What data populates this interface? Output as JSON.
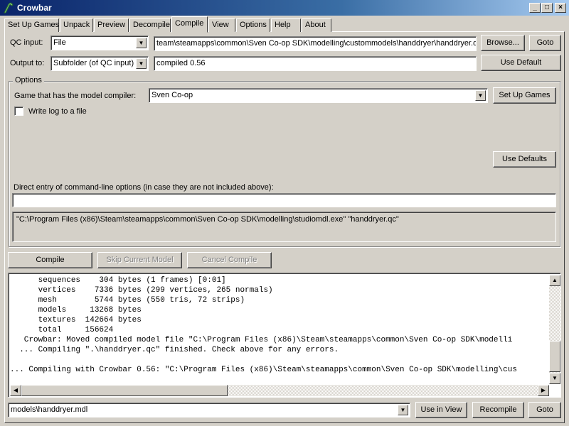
{
  "window": {
    "title": "Crowbar"
  },
  "tabs": [
    "Set Up Games",
    "Unpack",
    "Preview",
    "Decompile",
    "Compile",
    "View",
    "Options",
    "Help",
    "About"
  ],
  "compile": {
    "qc_input_label": "QC input:",
    "qc_input_mode": "File",
    "qc_input_path": "team\\steamapps\\common\\Sven Co-op SDK\\modelling\\custommodels\\handdryer\\handdryer.qc",
    "browse_label": "Browse...",
    "goto_label": "Goto",
    "output_label": "Output to:",
    "output_mode": "Subfolder (of QC input)",
    "output_value": "compiled 0.56",
    "use_default_label": "Use Default",
    "options_group_label": "Options",
    "game_label": "Game that has the model compiler:",
    "game_value": "Sven Co-op",
    "set_up_games_label": "Set Up Games",
    "write_log_label": "Write log to a file",
    "use_defaults_label": "Use Defaults",
    "direct_entry_label": "Direct entry of command-line options (in case they are not included above):",
    "direct_entry_value": "",
    "command_line": "\"C:\\Program Files (x86)\\Steam\\steamapps\\common\\Sven Co-op SDK\\modelling\\studiomdl.exe\" \"handdryer.qc\"",
    "compile_label": "Compile",
    "skip_label": "Skip Current Model",
    "cancel_label": "Cancel Compile"
  },
  "log_lines": [
    "      sequences    304 bytes (1 frames) [0:01]",
    "      vertices    7336 bytes (299 vertices, 265 normals)",
    "      mesh        5744 bytes (550 tris, 72 strips)",
    "      models     13268 bytes",
    "      textures  142664 bytes",
    "      total     156624",
    "   Crowbar: Moved compiled model file \"C:\\Program Files (x86)\\Steam\\steamapps\\common\\Sven Co-op SDK\\modelli",
    "  ... Compiling \".\\handdryer.qc\" finished. Check above for any errors.",
    "",
    "... Compiling with Crowbar 0.56: \"C:\\Program Files (x86)\\Steam\\steamapps\\common\\Sven Co-op SDK\\modelling\\cus"
  ],
  "bottom": {
    "output_file": "models\\handdryer.mdl",
    "use_in_view_label": "Use in View",
    "recompile_label": "Recompile",
    "goto_label": "Goto"
  },
  "titlebar_buttons": {
    "minimize": "_",
    "maximize": "□",
    "close": "×"
  }
}
